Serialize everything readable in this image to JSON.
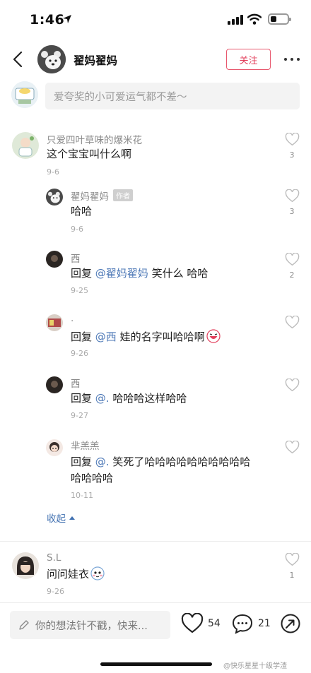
{
  "status_bar": {
    "time": "1:46"
  },
  "header": {
    "title": "翟妈翟妈",
    "follow_label": "关注"
  },
  "compose": {
    "placeholder": "爱夸奖的小可爱运气都不差～"
  },
  "comments": [
    {
      "name": "只爱四叶草味的爆米花",
      "text": "这个宝宝叫什么啊",
      "date": "9-6",
      "likes": "3"
    }
  ],
  "replies": [
    {
      "name": "翟妈翟妈",
      "author_tag": "作者",
      "text": "哈哈",
      "date": "9-6",
      "likes": "3"
    },
    {
      "name": "西",
      "prefix": "回复 ",
      "mention": "@翟妈翟妈",
      "text": " 笑什么 哈哈",
      "date": "9-25",
      "likes": "2"
    },
    {
      "name": ".",
      "prefix": "回复 ",
      "mention": "@西",
      "text": " 娃的名字叫哈哈啊",
      "date": "9-26",
      "likes": ""
    },
    {
      "name": "西",
      "prefix": "回复 ",
      "mention": "@.",
      "text": " 哈哈哈这样哈哈",
      "date": "9-27",
      "likes": ""
    },
    {
      "name": "芈羔羔",
      "prefix": "回复 ",
      "mention": "@.",
      "text": " 笑死了哈哈哈哈哈哈哈哈哈哈",
      "text_line2": "哈哈哈哈",
      "date": "10-11",
      "likes": ""
    }
  ],
  "collapse_label": "收起",
  "comment2": {
    "name": "S.L",
    "text": "问问娃衣",
    "date": "9-26",
    "likes": "1"
  },
  "bottom_bar": {
    "input_placeholder": "你的想法针不戳，快来...",
    "like_count": "54",
    "comment_count": "21"
  },
  "watermark": "@快乐星星十级学渣",
  "colors": {
    "accent": "#e23d5a",
    "link": "#3f6fb0",
    "mention": "#4b77b6"
  }
}
